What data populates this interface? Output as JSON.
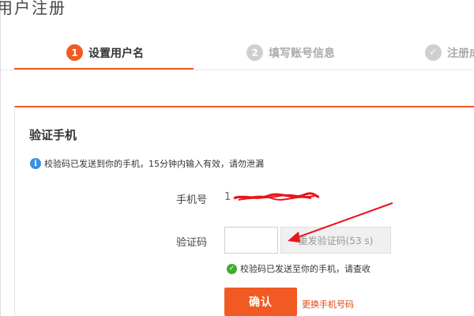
{
  "page": {
    "title": "用户注册"
  },
  "steps": [
    {
      "num": "1",
      "label": "设置用户名",
      "active": true
    },
    {
      "num": "2",
      "label": "填写账号信息",
      "active": false
    },
    {
      "num": "✓",
      "label": "注册成",
      "active": false
    }
  ],
  "panel": {
    "title": "验证手机",
    "info": "校验码已发送到你的手机，15分钟内输入有效，请勿泄漏"
  },
  "form": {
    "phone_label": "手机号",
    "phone_value": "1",
    "code_label": "验证码",
    "code_value": "",
    "resend_label": "重发验证码(53 s)",
    "sent_notice": "校验码已发送至你的手机，请查收",
    "confirm_label": "确认",
    "change_phone_label": "更换手机号码"
  },
  "colors": {
    "accent": "#f15a22",
    "info": "#3a8ee6",
    "success": "#3fae29",
    "annotation_red": "#e8141c"
  },
  "icons": {
    "info": "info-icon",
    "success": "check-circle-icon",
    "step_done": "checkmark-icon"
  }
}
